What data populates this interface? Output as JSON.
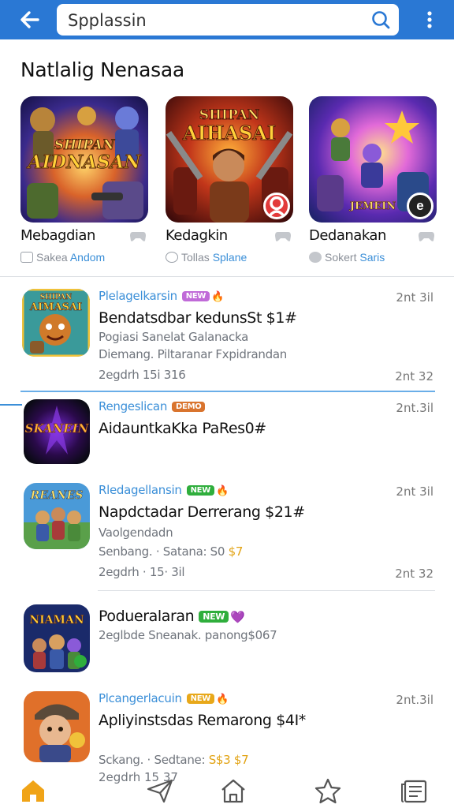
{
  "topbar": {
    "search_value": "Spplassin",
    "back_icon": "arrow-left-icon",
    "search_icon": "search-icon",
    "more_icon": "more-vertical-icon"
  },
  "section": {
    "title": "Natlalig Nenasaa"
  },
  "featured": [
    {
      "name": "Mebagdian",
      "meta_a": "Sakea",
      "meta_b": "Andom",
      "art_text_1": "SHIPAN",
      "art_text_2": "AIDNASAN",
      "control_icon": "gamepad-icon"
    },
    {
      "name": "Kedagkin",
      "meta_a": "Tollas",
      "meta_b": "Splane",
      "art_text_1": "SHIPAN",
      "art_text_2": "AIHASAI",
      "control_icon": "gamepad-icon"
    },
    {
      "name": "Dedanakan",
      "meta_a": "Sokert",
      "meta_b": "Saris",
      "art_text_1": "JEMEIN",
      "control_icon": "gamepad-icon"
    }
  ],
  "list": [
    {
      "category": "Plelagelkarsin",
      "tag": "NEW",
      "title": "Bendatsdbar kedunsSt $1#",
      "line1": "Pogiasi Sanelat Galanacka",
      "line2": "Diemang. Piltaranar Fxpidrandan",
      "line3": "2egdrh 15i 316",
      "time_top": "2nt 3il",
      "time_bottom": "2nt 32",
      "art_text_1": "SHIPAN",
      "art_text_2": "AIMASAI"
    },
    {
      "category": "Rengeslican",
      "tag": "DEMO",
      "title": "AidauntkaKka PaRes0#",
      "time_top": "2nt.3il",
      "art_text": "SKANEIN"
    },
    {
      "category": "Rledagellansin",
      "tag": "NEW",
      "title": "Napdctadar Derrerang $21#",
      "line1": "Vaolgendadn",
      "line2_prefix": "Senbang. · Satana: S0",
      "line2_price": "$7",
      "line3": "2egdrh · 15· 3il",
      "time_top": "2nt 3il",
      "time_bottom": "2nt 32",
      "art_text": "REANES"
    },
    {
      "title": "Podueralaran",
      "tag": "NEW",
      "line1": "2eglbde Sneanak. panong$067",
      "art_text": "NIAMAN"
    },
    {
      "category": "Plcangerlacuin",
      "tag": "NEW",
      "title": "Apliyinstsdas Remarong $4I*",
      "line2_prefix": "Sckang. · Sedtane:",
      "line2_price": "S$3 $7",
      "line3": "2egdrh 15 37",
      "time_top": "2nt.3il"
    }
  ],
  "bottomnav": [
    {
      "icon": "home-filled-icon"
    },
    {
      "icon": "paper-plane-icon"
    },
    {
      "icon": "home-outline-icon"
    },
    {
      "icon": "star-icon"
    },
    {
      "icon": "news-icon"
    }
  ],
  "colors": {
    "topbar": "#2a78d4",
    "accent": "#3b8fd8",
    "tag_purple": "#b057d6",
    "tag_orange": "#e0782a",
    "tag_green": "#2fae3c",
    "nav_active": "#f0a418"
  }
}
